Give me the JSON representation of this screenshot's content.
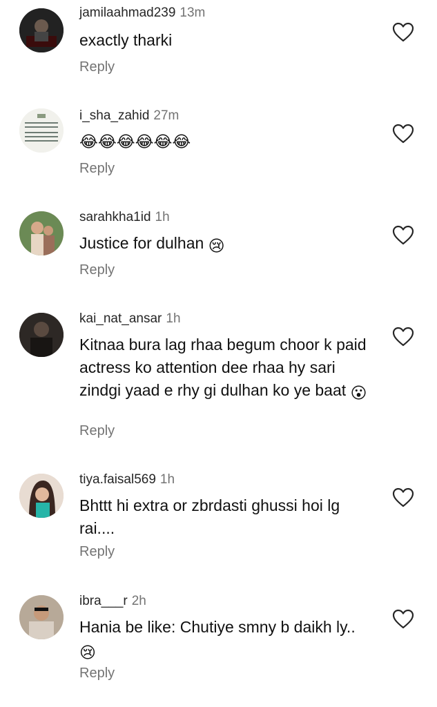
{
  "comments": [
    {
      "username": "jamilaahmad239",
      "time": "13m",
      "text": "exactly tharki",
      "reply": "Reply"
    },
    {
      "username": "i_sha_zahid",
      "time": "27m",
      "text": "😂😂😂😂😂😂",
      "reply": "Reply"
    },
    {
      "username": "sarahkha1id",
      "time": "1h",
      "text": "Justice for dulhan",
      "emoji": "😢",
      "reply": "Reply"
    },
    {
      "username": "kai_nat_ansar",
      "time": "1h",
      "text": "Kitnaa bura lag rhaa begum choor k paid actress ko attention dee rhaa hy sari zindgi yaad e rhy gi dulhan ko ye baat",
      "emoji": "😮",
      "reply": "Reply"
    },
    {
      "username": "tiya.faisal569",
      "time": "1h",
      "text": "Bhttt hi extra  or zbrdasti ghussi hoi lg rai....",
      "reply": "Reply"
    },
    {
      "username": "ibra___r",
      "time": "2h",
      "text": "Hania be like: Chutiye smny b daikh ly..",
      "emoji": "😢",
      "reply": "Reply"
    }
  ],
  "icons": {
    "like": "heart-outline-icon"
  },
  "colors": {
    "meta": "#737373",
    "text": "#111111",
    "background": "#ffffff"
  }
}
